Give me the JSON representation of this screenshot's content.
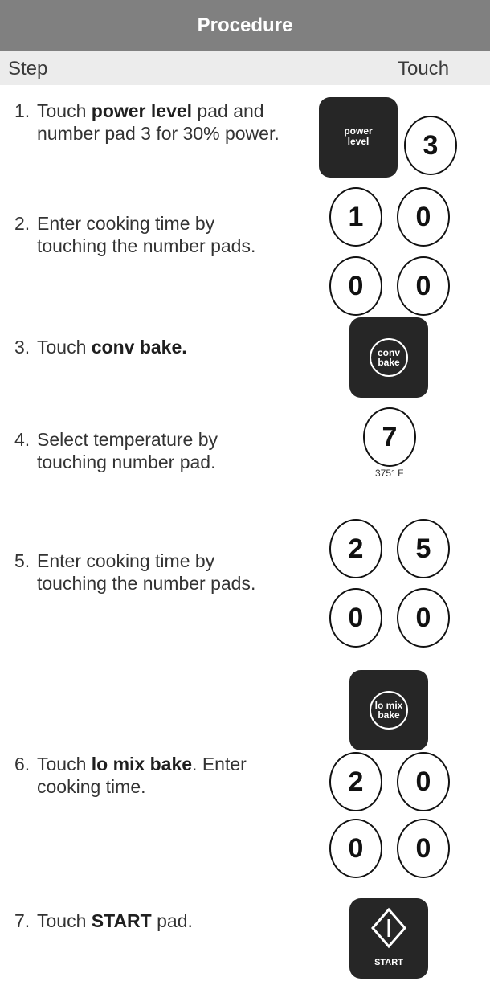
{
  "header": {
    "title": "Procedure"
  },
  "columns": {
    "step": "Step",
    "touch": "Touch"
  },
  "steps": [
    {
      "num": "1.",
      "pre": "Touch ",
      "bold": "power level",
      "post": " pad and number pad 3 for 30% power."
    },
    {
      "num": "2.",
      "text": "Enter cooking time by touching the number pads."
    },
    {
      "num": "3.",
      "pre": "Touch ",
      "bold": "conv bake.",
      "post": ""
    },
    {
      "num": "4.",
      "text": "Select temperature by touching number pad."
    },
    {
      "num": "5.",
      "text": "Enter cooking time by touching the number pads."
    },
    {
      "num": "6.",
      "pre": "Touch ",
      "bold": "lo mix bake",
      "post": ". Enter cooking time."
    },
    {
      "num": "7.",
      "pre": "Touch ",
      "bold": "START",
      "post": " pad."
    }
  ],
  "pads": {
    "power_level": {
      "line1": "power",
      "line2": "level"
    },
    "conv_bake": {
      "line1": "conv",
      "line2": "bake"
    },
    "lo_mix_bake": {
      "line1": "lo mix",
      "line2": "bake"
    },
    "start": {
      "label": "START"
    },
    "temp_caption": "375° F",
    "digits": [
      "3",
      "1",
      "0",
      "0",
      "0",
      "7",
      "2",
      "5",
      "0",
      "0",
      "2",
      "0",
      "0",
      "0"
    ]
  }
}
